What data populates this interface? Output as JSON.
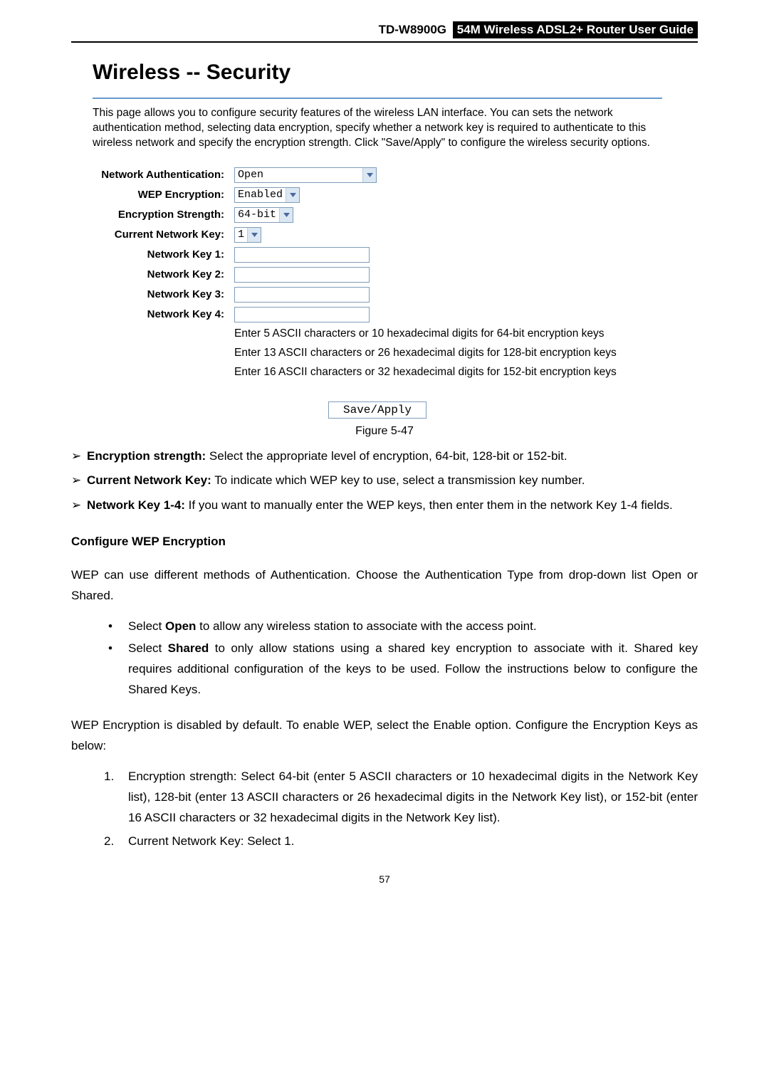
{
  "header": {
    "model": "TD-W8900G",
    "title": "54M  Wireless  ADSL2+  Router  User  Guide"
  },
  "shot": {
    "heading": "Wireless -- Security",
    "intro": "This page allows you to configure security features of the wireless LAN interface. You can sets the network authentication method, selecting data encryption, specify whether a network key is required to authenticate to this wireless network and specify the encryption strength. Click \"Save/Apply\" to configure the wireless security options.",
    "labels": {
      "net_auth": "Network Authentication:",
      "wep_enc": "WEP Encryption:",
      "enc_str": "Encryption Strength:",
      "cur_key": "Current Network Key:",
      "key1": "Network Key 1:",
      "key2": "Network Key 2:",
      "key3": "Network Key 3:",
      "key4": "Network Key 4:"
    },
    "values": {
      "net_auth": "Open",
      "wep_enc": "Enabled",
      "enc_str": "64-bit",
      "cur_key": "1"
    },
    "key_note_lines": [
      "Enter 5 ASCII characters or 10 hexadecimal digits for 64-bit encryption keys",
      "Enter 13 ASCII characters or 26 hexadecimal digits for 128-bit encryption keys",
      "Enter 16 ASCII characters or 32 hexadecimal digits for 152-bit encryption keys"
    ],
    "save_label": "Save/Apply"
  },
  "figure_caption": "Figure 5-47",
  "arrow_items": [
    {
      "lead": "Encryption strength:",
      "rest": " Select the appropriate level of encryption, 64-bit, 128-bit or 152-bit."
    },
    {
      "lead": "Current Network Key:",
      "rest": " To indicate which WEP key to use, select a transmission key number."
    },
    {
      "lead": "Network Key 1-4:",
      "rest": " If you want to manually enter the WEP keys, then enter them in the network Key 1-4 fields."
    }
  ],
  "section_head": "Configure WEP Encryption",
  "para1": "WEP can use different methods of Authentication. Choose the Authentication Type from drop-down list Open or Shared.",
  "dot_items": [
    {
      "pre": "Select ",
      "bold": "Open",
      "post": " to allow any wireless station to associate with the access point."
    },
    {
      "pre": "Select ",
      "bold": "Shared",
      "post": " to only allow stations using a shared key encryption to associate with it. Shared key requires additional configuration of the keys to be used. Follow the instructions below to configure the Shared Keys."
    }
  ],
  "para2": "WEP Encryption is disabled by default. To enable WEP, select the Enable option. Configure the Encryption Keys as below:",
  "num_items": [
    "Encryption strength: Select 64-bit (enter 5 ASCII characters or 10 hexadecimal digits in the Network Key list), 128-bit (enter 13 ASCII characters or 26 hexadecimal digits in the Network Key list), or 152-bit (enter 16 ASCII characters or 32 hexadecimal digits in the Network Key list).",
    "Current Network Key: Select 1."
  ],
  "page_number": "57"
}
